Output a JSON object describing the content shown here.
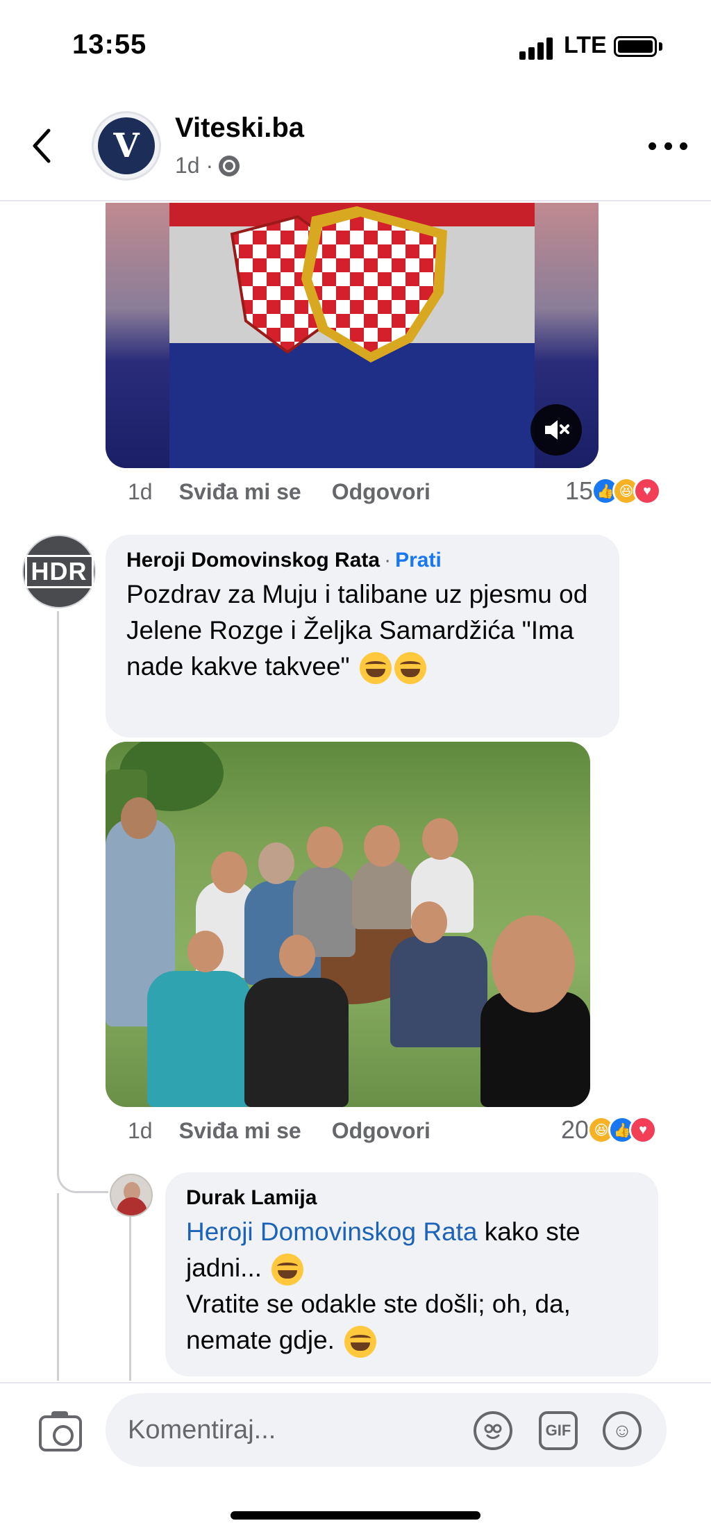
{
  "status": {
    "time": "13:55",
    "network": "LTE"
  },
  "header": {
    "page_name": "Viteski.ba",
    "meta_time": "1d ·",
    "avatar_letter": "V"
  },
  "video_post": {
    "time": "1d",
    "like_label": "Sviđa mi se",
    "reply_label": "Odgovori",
    "reaction_count": "15",
    "reactions": [
      "like",
      "haha",
      "love"
    ]
  },
  "comment1": {
    "author": "Heroji Domovinskog Rata",
    "separator": "·",
    "follow_label": "Prati",
    "text": "Pozdrav za Muju i talibane uz pjesmu od Jelene Rozge i Željka Samardžića \"Ima nade kakve takvee\"",
    "avatar_text": "HDR",
    "time": "1d",
    "like_label": "Sviđa mi se",
    "reply_label": "Odgovori",
    "reaction_count": "20",
    "reactions": [
      "haha",
      "like",
      "love"
    ]
  },
  "comment2": {
    "author": "Durak Lamija",
    "mention": "Heroji Domovinskog Rata",
    "text_line1": " kako ste jadni...",
    "text_line2": "Vratite se odakle ste došli; oh, da, nemate gdje."
  },
  "composer": {
    "placeholder": "Komentiraj...",
    "gif_label": "GIF",
    "emoji_glyph": "☺"
  }
}
